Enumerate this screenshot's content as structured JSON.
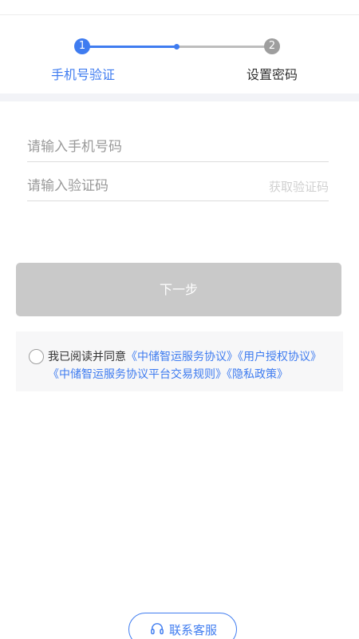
{
  "stepper": {
    "steps": [
      {
        "number": "1",
        "label": "手机号验证"
      },
      {
        "number": "2",
        "label": "设置密码"
      }
    ],
    "active_color": "#3f7cf0",
    "inactive_color": "#9e9e9e"
  },
  "form": {
    "phone_placeholder": "请输入手机号码",
    "code_placeholder": "请输入验证码",
    "get_code_label": "获取验证码"
  },
  "next_button": {
    "label": "下一步",
    "color": "#c9c9c9"
  },
  "agreement": {
    "prefix": "我已阅读并同意",
    "links": [
      "《中储智运服务协议》",
      "《用户授权协议》",
      "《中储智运服务协议平台交易规则》",
      "《隐私政策》"
    ]
  },
  "support": {
    "icon": "headset-icon",
    "label": "联系客服"
  }
}
